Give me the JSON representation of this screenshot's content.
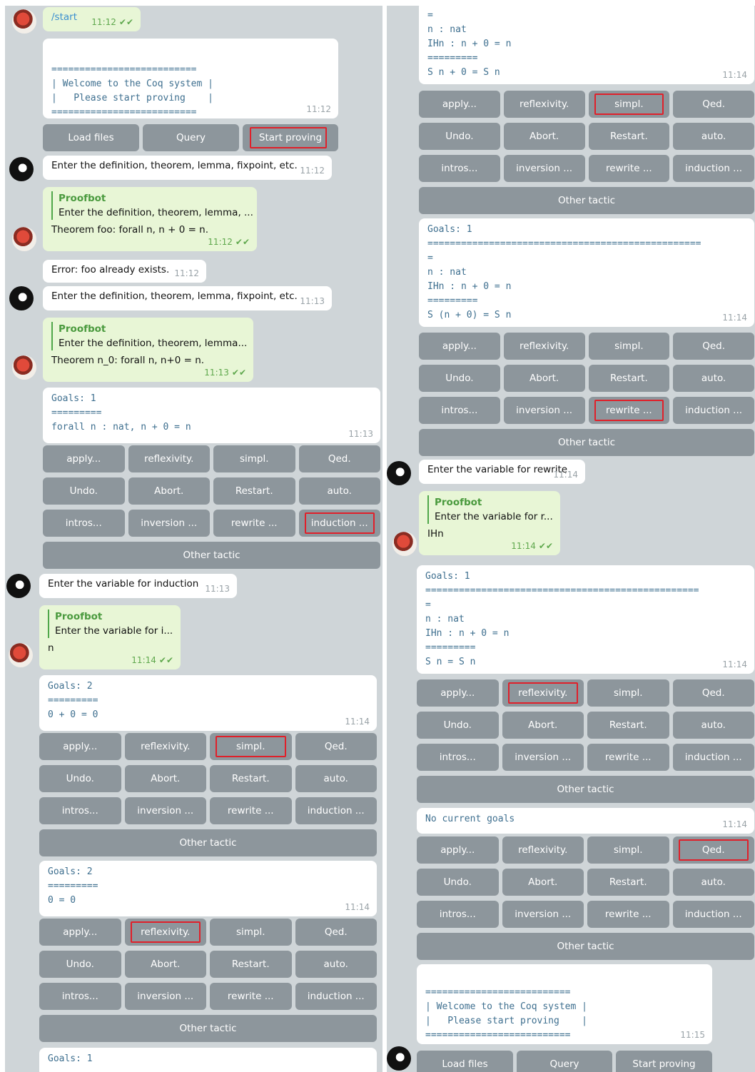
{
  "times": [
    "11:12",
    "11:13",
    "11:14",
    "11:15"
  ],
  "start_cmd": "/start",
  "welcome": "==========================\n| Welcome to the Coq system |\n|   Please start proving    |\n==========================",
  "start_buttons": [
    "Load files",
    "Query",
    "Start proving"
  ],
  "prompt_def": "Enter the definition, theorem, lemma, fixpoint, etc.",
  "proofbot": "Proofbot",
  "quote_def1": "Enter the definition, theorem, lemma, ...",
  "quote_def2": "Enter the definition, theorem, lemma...",
  "theorem_foo": "Theorem foo: forall n, n + 0 = n.",
  "error_foo": "Error: foo already exists.",
  "theorem_n0": "Theorem n_0: forall n, n+0 = n.",
  "goal1": "Goals: 1\n=========\nforall n : nat, n + 0 = n",
  "tactics": {
    "apply": "apply...",
    "refl": "reflexivity.",
    "simpl": "simpl.",
    "qed": "Qed.",
    "undo": "Undo.",
    "abort": "Abort.",
    "restart": "Restart.",
    "auto": "auto.",
    "intros": "intros...",
    "inversion": "inversion ...",
    "rewrite": "rewrite ...",
    "induction": "induction ...",
    "other": "Other tactic"
  },
  "prompt_induction": "Enter the variable for induction",
  "quote_ind": "Enter the variable for i...",
  "reply_n": "n",
  "goal2a": "Goals: 2\n=========\n0 + 0 = 0",
  "goal2b": "Goals: 2\n=========\n0 = 0",
  "goal_last_partial": "Goals: 1",
  "r_goal_top": "=\nn : nat\nIHn : n + 0 = n\n=========\nS n + 0 = S n",
  "r_goal_2": "Goals: 1\n=================================================\n=\nn : nat\nIHn : n + 0 = n\n=========\nS (n + 0) = S n",
  "prompt_rewrite": "Enter the variable for rewrite",
  "quote_rw": "Enter the variable for r...",
  "reply_ihn": "IHn",
  "r_goal_3": "Goals: 1\n=================================================\n=\nn : nat\nIHn : n + 0 = n\n=========\nS n = S n",
  "no_goals": "No current goals",
  "colors": {
    "button": "#8d969c",
    "highlight": "#e0202a",
    "outgoing": "#e8f6d6",
    "code": "#3e6f8f"
  }
}
